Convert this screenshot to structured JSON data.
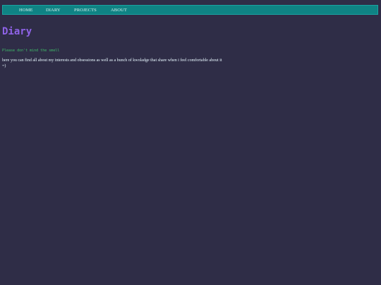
{
  "nav": {
    "items": [
      {
        "label": "HOME"
      },
      {
        "label": "DIARY"
      },
      {
        "label": "PROJECTS"
      },
      {
        "label": "ABOUT"
      }
    ]
  },
  "main": {
    "title": "Diary",
    "subtitle": "Please don't mind the smell",
    "intro": "here you can find all about my interests and obsessions as well as a bunch of kwoladge that share when i feel comfortable about it",
    "emoticon": "=)"
  },
  "colors": {
    "background": "#2f2d47",
    "navbar": "#0f8384",
    "title": "#8f63e8",
    "subtitle": "#3fbf6a",
    "text": "#e8f8ff"
  }
}
